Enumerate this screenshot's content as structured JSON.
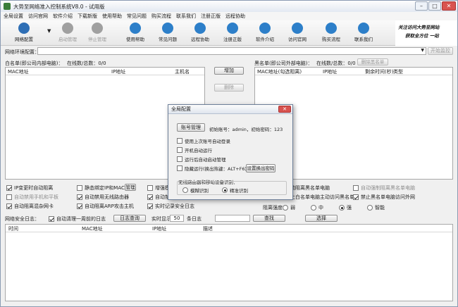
{
  "title": "大势至网络准入控制系统V8.0 - 试用版",
  "menu": [
    "全局设置",
    "访问官网",
    "软件介绍",
    "下载新版",
    "使用帮助",
    "常见问题",
    "购买流程",
    "联系我们",
    "注册正版",
    "远程协助"
  ],
  "toolbar": [
    {
      "label": "网络配置",
      "icon": "settings-icon",
      "color": "#2f6fb5",
      "enabled": true
    },
    {
      "label": "启动管理",
      "icon": "start-icon",
      "color": "#a0a0a0",
      "enabled": false
    },
    {
      "label": "停止管理",
      "icon": "stop-icon",
      "color": "#a0a0a0",
      "enabled": false
    },
    {
      "label": "使用帮助",
      "icon": "help-icon",
      "color": "#2d7fc9",
      "enabled": true
    },
    {
      "label": "常见问题",
      "icon": "faq-icon",
      "color": "#2d7fc9",
      "enabled": true
    },
    {
      "label": "远程协助",
      "icon": "remote-icon",
      "color": "#2d7fc9",
      "enabled": true
    },
    {
      "label": "注册正版",
      "icon": "register-icon",
      "color": "#2d7fc9",
      "enabled": true
    },
    {
      "label": "软件介绍",
      "icon": "gear-icon",
      "color": "#2d7fc9",
      "enabled": true
    },
    {
      "label": "访问官网",
      "icon": "website-icon",
      "color": "#2d7fc9",
      "enabled": true
    },
    {
      "label": "购买流程",
      "icon": "cart-icon",
      "color": "#2d7fc9",
      "enabled": true
    },
    {
      "label": "联系我们",
      "icon": "contact-icon",
      "color": "#2d7fc9",
      "enabled": true
    }
  ],
  "banner": {
    "line1": "关注访问大势至网站",
    "line2": "获取全方位 一站"
  },
  "env": {
    "label": "网络环境配置：",
    "start_button": "开始监控"
  },
  "whitelist": {
    "title": "白名单(即公司内部电脑)：",
    "stats": "在线数/总数：0/0",
    "columns": [
      "MAC地址",
      "IP地址",
      "主机名"
    ]
  },
  "blacklist": {
    "title": "黑名单(即公司外部电脑)：",
    "stats": "在线数/总数：0/0",
    "delete_button": "删除黑名单",
    "columns": [
      "MAC地址(勾选阻离)",
      "IP地址",
      "剩余时间(秒)",
      "类型"
    ]
  },
  "mid_buttons": {
    "add": "增加",
    "remove": "删除"
  },
  "options": [
    {
      "label": "IP变更时自动阻离",
      "checked": true
    },
    {
      "label": "静态绑定IP和MAC",
      "checked": false
    },
    {
      "label": "管理",
      "button": true
    },
    {
      "label": "增强模式",
      "checked": false
    },
    {
      "label": "动阻离黑名单电脑",
      "checked": false
    },
    {
      "label": "自动强制阻离黑名单电脑",
      "checked": false,
      "disabled": true
    },
    {
      "label": "自动禁用手机和平板",
      "checked": false,
      "disabled": true
    },
    {
      "label": "自动禁用无线路由器",
      "checked": true
    },
    {
      "label": "自动禁用",
      "checked": true
    },
    {
      "label": "止白名单电脑主动访问黑名单",
      "checked": false
    },
    {
      "label": "禁止黑名单电脑访问外网",
      "checked": true
    },
    {
      "label": "自动阻离混杂网卡",
      "checked": true
    },
    {
      "label": "自动阻离ARP攻击主机",
      "checked": true
    },
    {
      "label": "实时记录安全日志",
      "checked": true
    }
  ],
  "strength": {
    "label": "阻离强度：",
    "options": [
      "弱",
      "中",
      "强",
      "智能"
    ],
    "selected": "强"
  },
  "log": {
    "title": "网络安全日志：",
    "auto_clean": "自动清理一周前的日志",
    "query_button": "日志查询",
    "realtime": "实时显示",
    "count": "50",
    "count_suffix": "条日志",
    "search_button": "查找",
    "select_button": "选择",
    "columns": [
      "时间",
      "MAC地址",
      "IP地址",
      "描述"
    ]
  },
  "dialog": {
    "title": "全局配置",
    "account_button": "账号管理",
    "initial_info": "初始账号：admin，初始密码：123",
    "checks": [
      {
        "label": "使用上次账号自动登录",
        "checked": false
      },
      {
        "label": "开机自动运行",
        "checked": false
      },
      {
        "label": "运行后自动启动管理",
        "checked": false
      },
      {
        "label": "隐藏运行(换出热键：ALT+F6)",
        "checked": false
      }
    ],
    "hotkey_button": "设置换出密码",
    "router_label": "无线路由器和移动设备识别：",
    "radios": [
      "模糊识别",
      "精准识别"
    ],
    "radio_selected": "精准识别"
  }
}
